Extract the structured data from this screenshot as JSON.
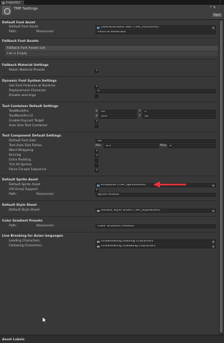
{
  "tab": {
    "label": "Inspector"
  },
  "header": {
    "title": "TMP Settings",
    "open_label": "Open"
  },
  "sections": {
    "default_font": "Default Font Asset",
    "fallback_font": "Fallback Font Assets",
    "fallback_material": "Fallback Material Settings",
    "dynamic_font": "Dynamic Font System Settings",
    "text_container": "Text Container Default Settings",
    "text_component": "Text Component Default Settings",
    "sprite": "Default Sprite Asset",
    "style": "Default Style Sheet",
    "color_gradient": "Color Gradient Presets",
    "line_breaking": "Line Breaking for Asian languages"
  },
  "default_font": {
    "asset_label": "Default Font Asset",
    "asset_value": "LiberationSans SDF (TMP_FontAsset)",
    "path_label": "Path:",
    "path_prefix": "Resources/",
    "path_value": "Fonts & Materials/"
  },
  "fallback_font": {
    "list_label": "Fallback Font Assets List",
    "empty_label": "List is Empty"
  },
  "fallback_material": {
    "match_label": "Match Material Presets",
    "match_checked": true
  },
  "dynamic_font": {
    "get_features_label": "Get Font Features at Runtime",
    "get_features_checked": true,
    "replacement_label": "Replacement Character",
    "replacement_value": "0",
    "disable_warnings_label": "Disable warnings",
    "disable_warnings_checked": false
  },
  "text_container": {
    "textmeshpro_label": "TextMeshPro",
    "textmeshpro_x": "20",
    "textmeshpro_y": "5",
    "textmeshpro_ui_label": "TextMeshPro UI",
    "textmeshpro_ui_x": "200",
    "textmeshpro_ui_y": "50",
    "raycast_label": "Enable Raycast Target",
    "raycast_checked": true,
    "autosize_label": "Auto Size Text Container",
    "autosize_checked": false,
    "x_label": "X",
    "y_label": "Y"
  },
  "text_component": {
    "font_size_label": "Default Font Size",
    "font_size_value": "36",
    "autosize_ratios_label": "Text Auto Size Ratios",
    "min_label": "Min",
    "min_value": "0.5",
    "max_label": "Max",
    "max_value": "2",
    "word_wrapping_label": "Word Wrapping",
    "word_wrapping_checked": true,
    "kerning_label": "Kerning",
    "kerning_checked": true,
    "extra_padding_label": "Extra Padding",
    "extra_padding_checked": false,
    "tint_sprites_label": "Tint All Sprites",
    "tint_sprites_checked": false,
    "parse_escape_label": "Parse Escape Sequence",
    "parse_escape_checked": true
  },
  "sprite": {
    "asset_label": "Default Sprite Asset",
    "asset_value": "EmojiOne (TMP_SpriteAsset)",
    "ios_label": "iOS Emoji Support",
    "ios_checked": true,
    "path_label": "Path:",
    "path_prefix": "Resources/",
    "path_value": "Sprite Assets/"
  },
  "style": {
    "label": "Default Style Sheet",
    "value": "Default Style Sheet (TMP_StyleSheet)"
  },
  "color_gradient": {
    "path_label": "Path:",
    "path_prefix": "Resources/",
    "path_value": "Color Gradient Presets/"
  },
  "line_breaking": {
    "leading_label": "Leading Characters",
    "leading_value": "LineBreaking Leading Characters",
    "following_label": "Following Characters",
    "following_value": "LineBreaking Following Characters"
  },
  "footer": {
    "label": "Asset Labels"
  },
  "colors": {
    "annotation_arrow": "#e8323c",
    "background": "#383838",
    "field": "#2a2a2a"
  }
}
